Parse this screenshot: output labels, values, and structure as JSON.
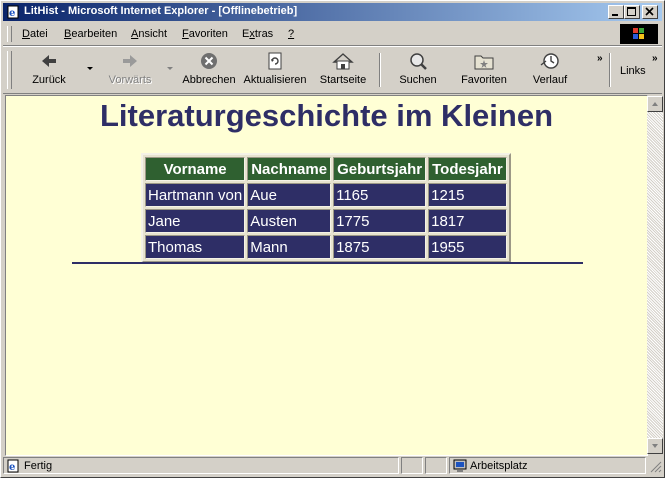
{
  "window": {
    "title": "LitHist - Microsoft Internet Explorer - [Offlinebetrieb]"
  },
  "menu": {
    "items": [
      {
        "label": "Datei",
        "u": "D",
        "rest": "atei"
      },
      {
        "label": "Bearbeiten",
        "u": "B",
        "rest": "earbeiten"
      },
      {
        "label": "Ansicht",
        "u": "A",
        "rest": "nsicht"
      },
      {
        "label": "Favoriten",
        "u": "F",
        "rest": "avoriten"
      },
      {
        "label": "Extras",
        "u": "x",
        "pre": "E",
        "rest": "tras"
      },
      {
        "label": "?",
        "u": "?",
        "rest": ""
      }
    ]
  },
  "toolbar": {
    "back": "Zurück",
    "forward": "Vorwärts",
    "stop": "Abbrechen",
    "refresh": "Aktualisieren",
    "home": "Startseite",
    "search": "Suchen",
    "favorites": "Favoriten",
    "history": "Verlauf",
    "links": "Links",
    "chevron": "»"
  },
  "page": {
    "heading": "Literaturgeschichte im Kleinen",
    "table": {
      "headers": [
        "Vorname",
        "Nachname",
        "Geburtsjahr",
        "Todesjahr"
      ],
      "rows": [
        [
          "Hartmann von",
          "Aue",
          "1165",
          "1215"
        ],
        [
          "Jane",
          "Austen",
          "1775",
          "1817"
        ],
        [
          "Thomas",
          "Mann",
          "1875",
          "1955"
        ]
      ]
    },
    "colors": {
      "heading": "#2e2e66",
      "header_bg": "#2f6030",
      "cell_bg": "#2e2e66",
      "page_bg": "#ffffd5"
    }
  },
  "status": {
    "text": "Fertig",
    "zone": "Arbeitsplatz"
  }
}
